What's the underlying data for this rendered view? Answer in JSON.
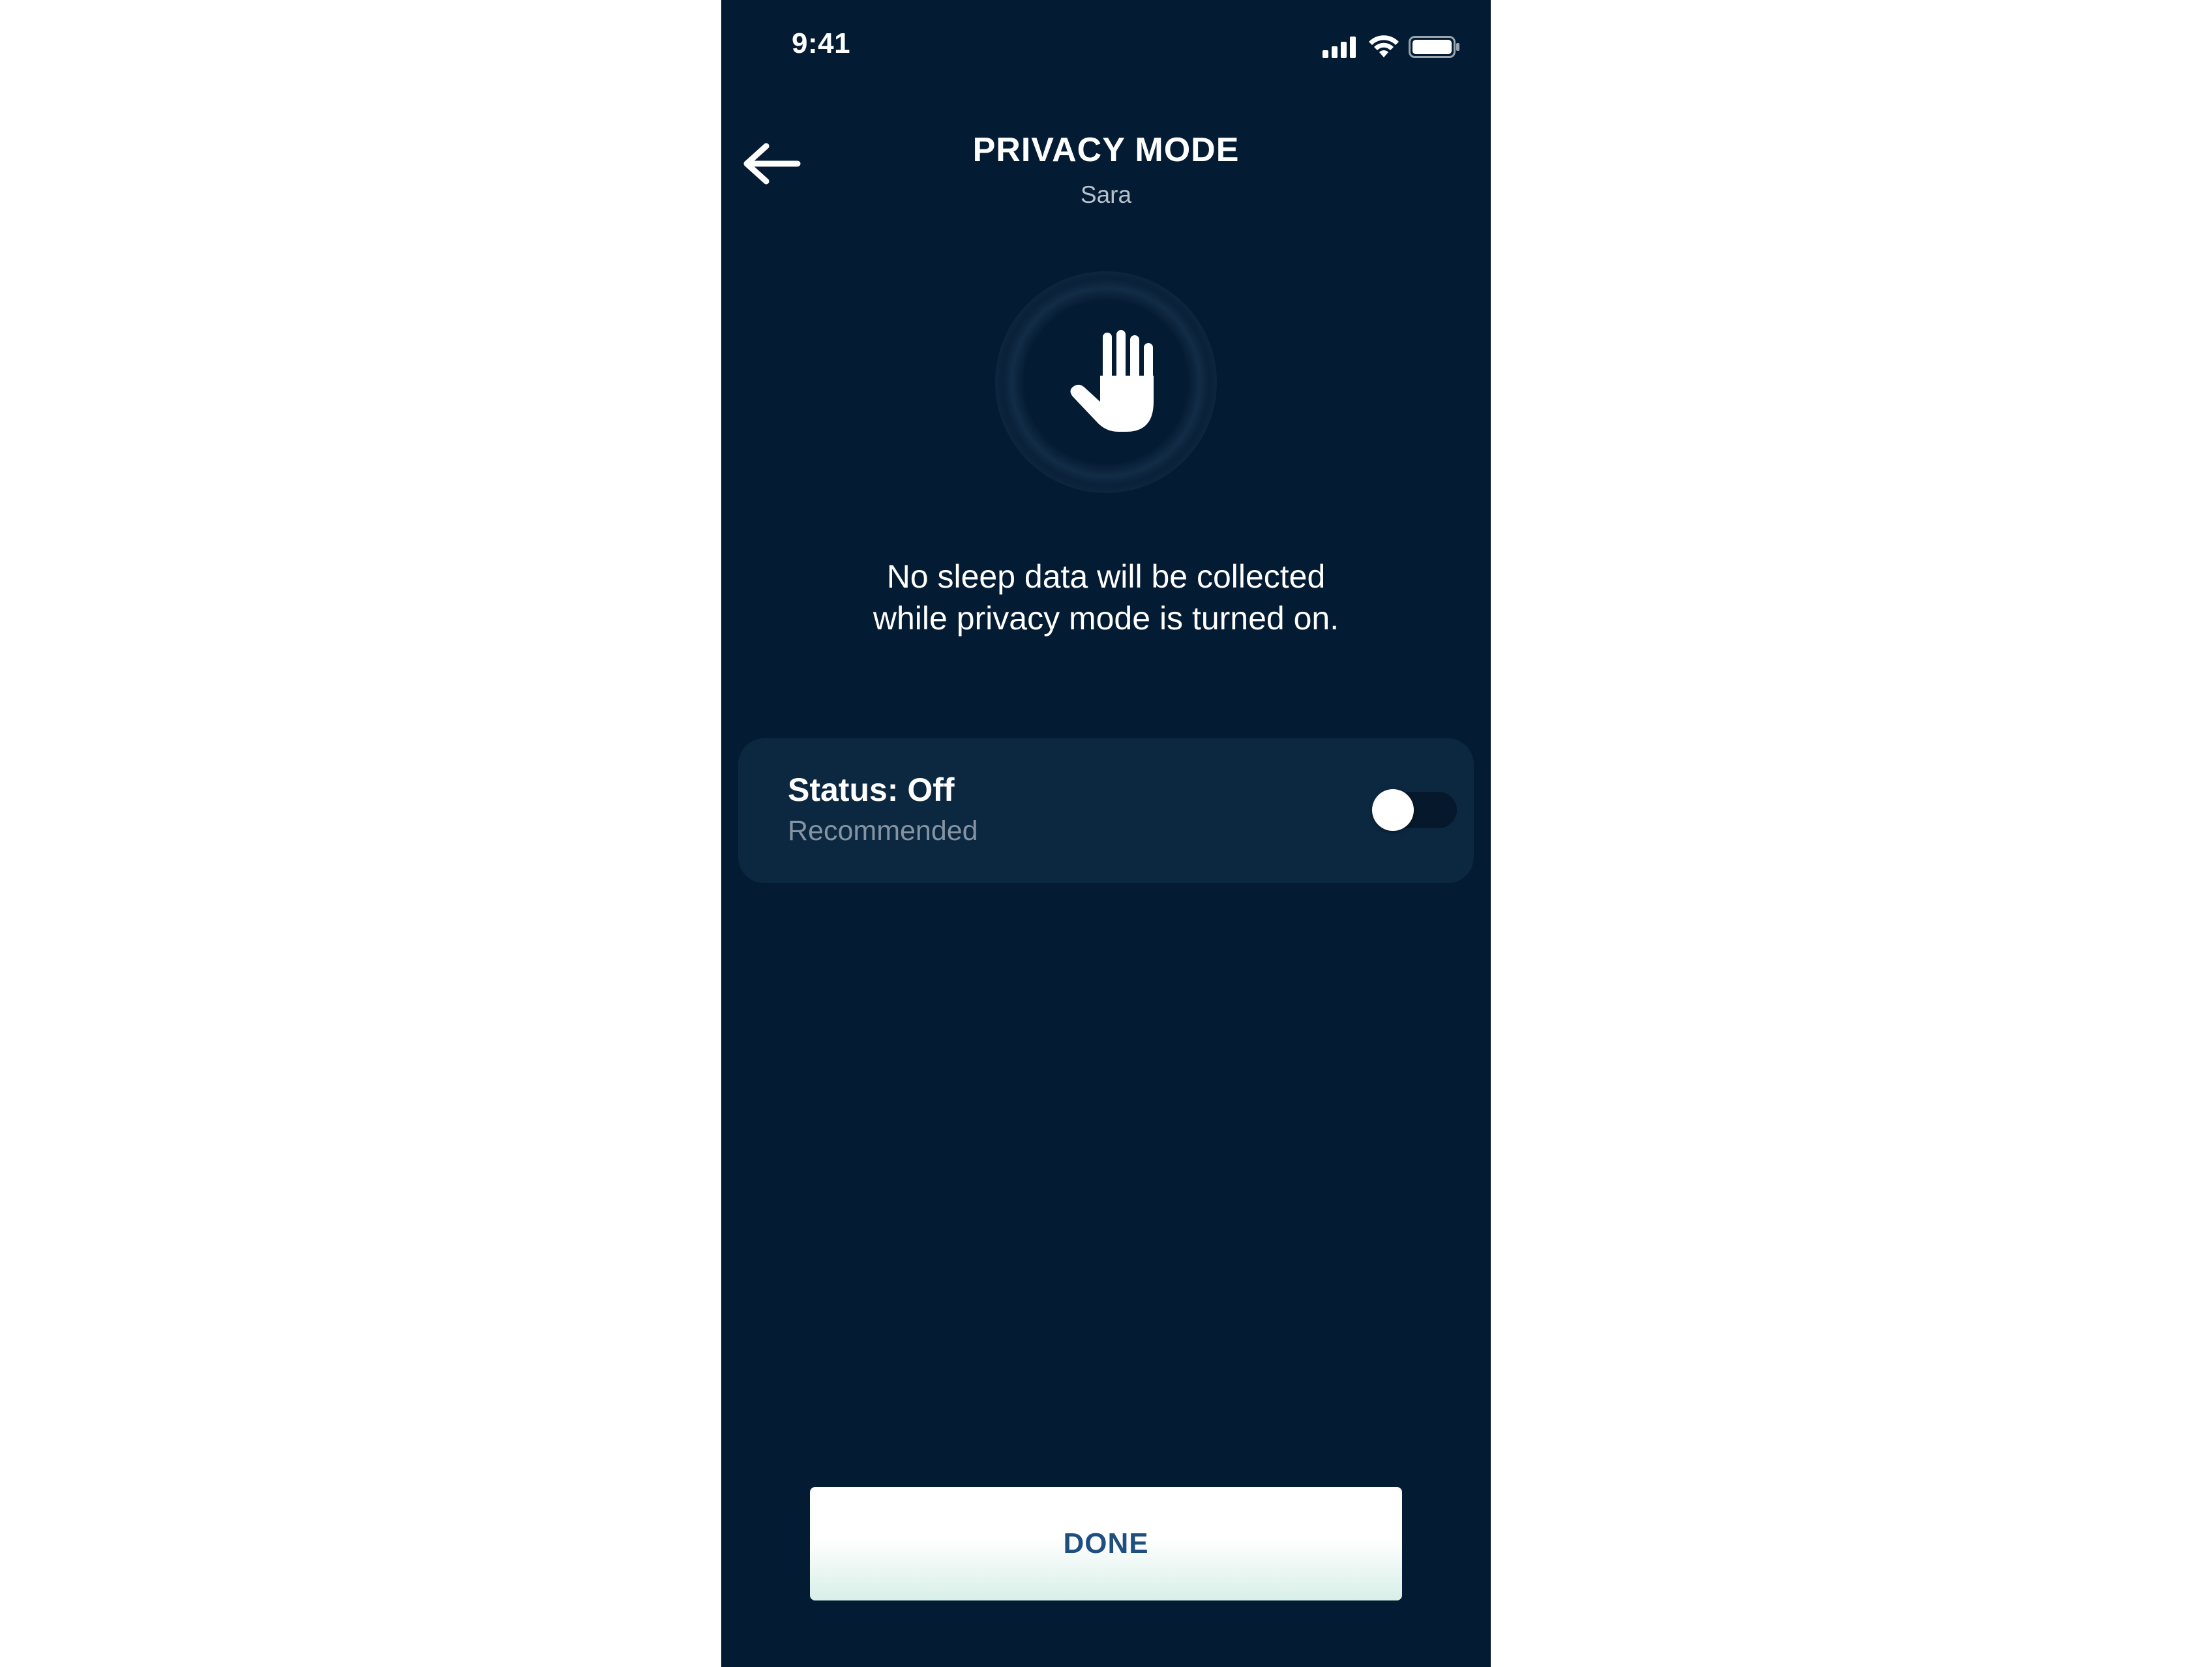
{
  "status_bar": {
    "time": "9:41",
    "icons": [
      "cellular-signal-icon",
      "wifi-icon",
      "battery-icon"
    ]
  },
  "header": {
    "title": "PRIVACY MODE",
    "subtitle": "Sara",
    "back_icon": "back-arrow-icon"
  },
  "hero": {
    "icon": "raised-hand-icon",
    "description_line1": "No sleep data will be collected",
    "description_line2": "while privacy mode is turned on."
  },
  "status_card": {
    "label": "Status: Off",
    "sublabel": "Recommended",
    "toggle_on": false
  },
  "footer": {
    "done_label": "DONE"
  },
  "colors": {
    "background": "#041c33",
    "card": "#0c2840",
    "button_text": "#1f4f80",
    "muted_text": "#8593a2"
  }
}
